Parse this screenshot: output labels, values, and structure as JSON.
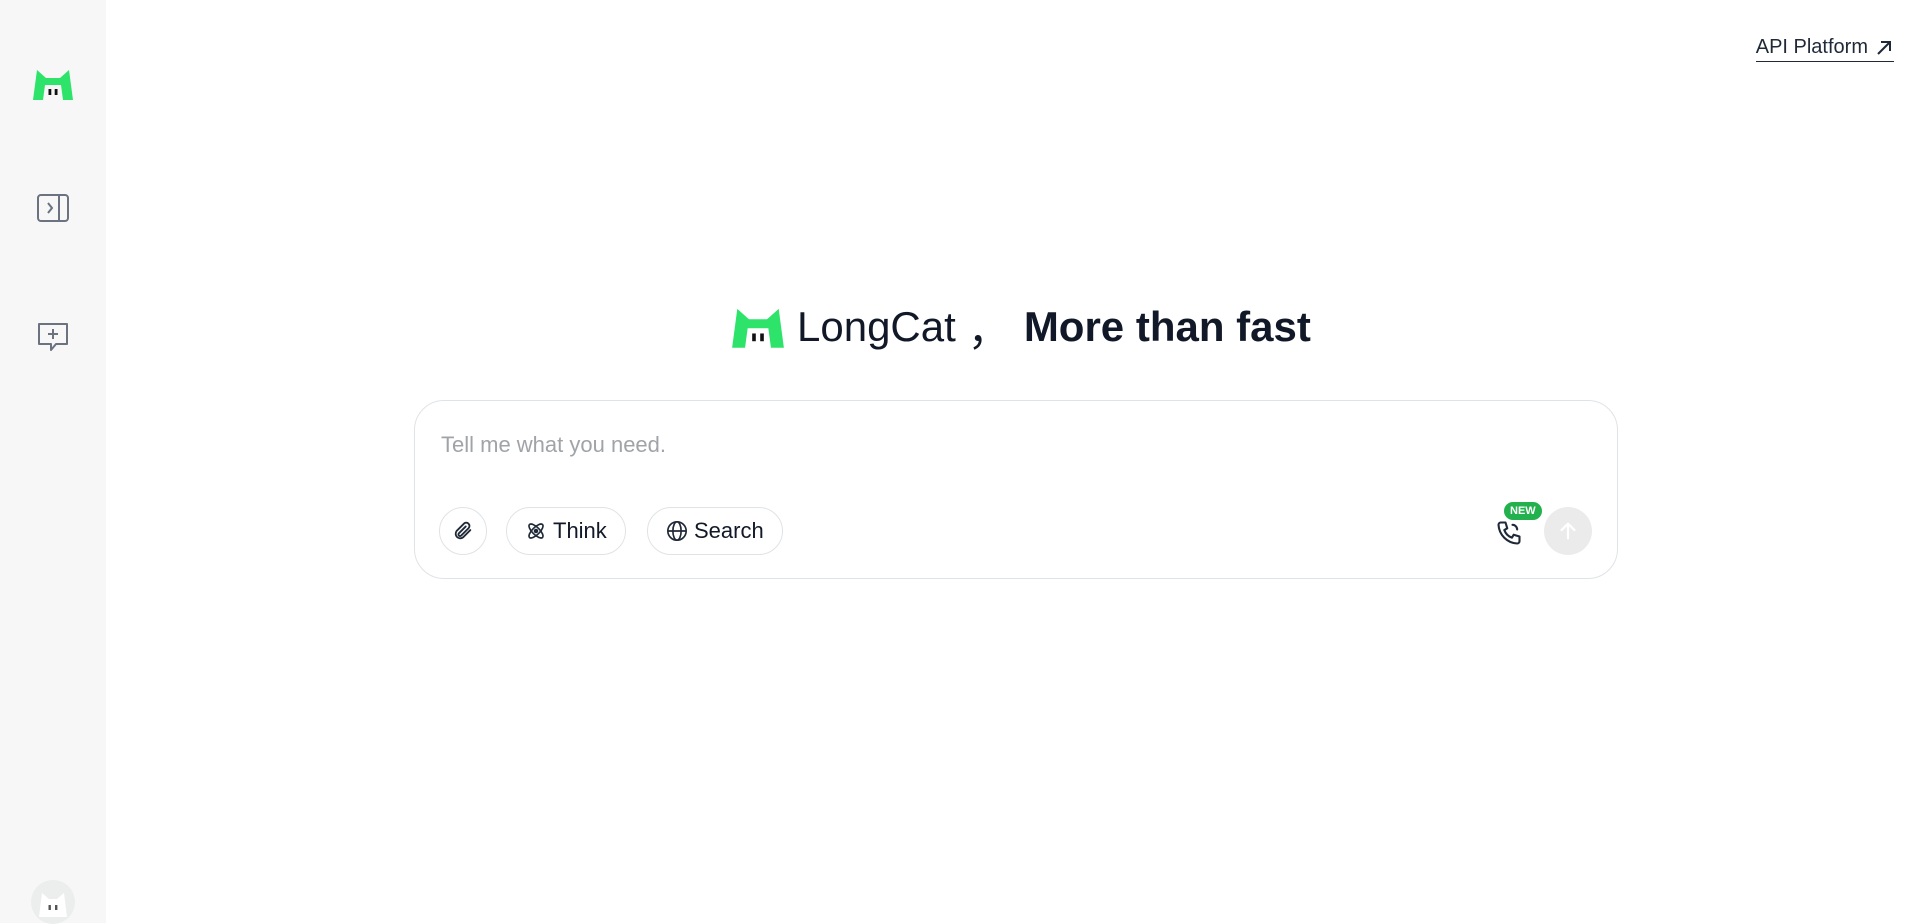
{
  "header": {
    "api_link_label": "API Platform"
  },
  "sidebar": {
    "items": [
      {
        "name": "logo",
        "icon": "longcat-logo-icon"
      },
      {
        "name": "expand-sidebar",
        "icon": "sidebar-expand-icon"
      },
      {
        "name": "new-chat",
        "icon": "new-chat-icon"
      },
      {
        "name": "user-avatar",
        "icon": "cat-avatar-icon"
      }
    ]
  },
  "hero": {
    "brand": "LongCat",
    "separator": "，",
    "slogan": "More than fast"
  },
  "composer": {
    "placeholder": "Tell me what you need.",
    "value": "",
    "think_label": "Think",
    "search_label": "Search",
    "voice_badge": "NEW"
  },
  "colors": {
    "brand_green": "#2ee36a",
    "badge_green": "#22b14c",
    "sidebar_bg": "#f6f7f6",
    "text": "#111827",
    "send_disabled_bg": "#ebebeb"
  }
}
